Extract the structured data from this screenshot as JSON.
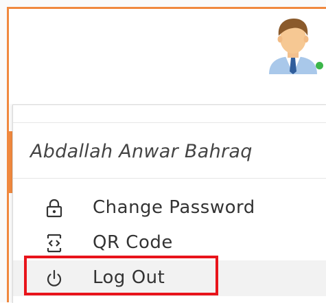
{
  "user": {
    "name": "Abdallah Anwar Bahraq",
    "status_color": "#3cb64a"
  },
  "menu": {
    "items": [
      {
        "label": "Change Password",
        "icon": "lock-icon"
      },
      {
        "label": "QR Code",
        "icon": "qr-code-icon"
      },
      {
        "label": "Log Out",
        "icon": "power-icon",
        "highlighted": true
      }
    ]
  },
  "colors": {
    "accent": "#f0883e",
    "highlight_border": "#e8141b",
    "hover_background": "#f2f2f2"
  }
}
